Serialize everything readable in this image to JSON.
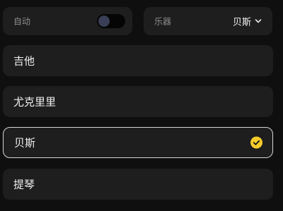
{
  "auto": {
    "label": "自动",
    "enabled": false
  },
  "instrument": {
    "label": "乐器",
    "selected": "贝斯",
    "dropdown_icon": "chevron-down-icon"
  },
  "options": [
    {
      "label": "吉他",
      "selected": false
    },
    {
      "label": "尤克里里",
      "selected": false
    },
    {
      "label": "贝斯",
      "selected": true
    },
    {
      "label": "提琴",
      "selected": false
    }
  ],
  "colors": {
    "accent": "#f5cc2a",
    "card": "#1e1e1e",
    "background": "#0f0f0f"
  }
}
